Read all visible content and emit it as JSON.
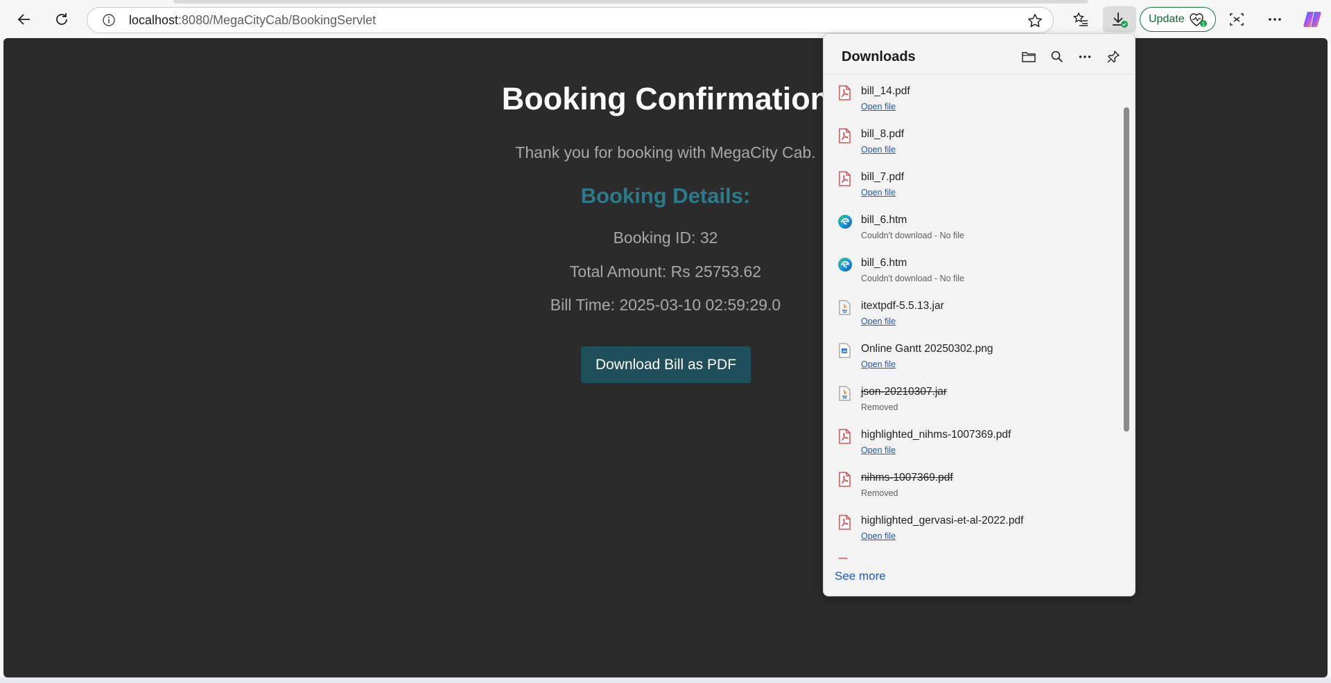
{
  "browser": {
    "url_host": "localhost",
    "url_path": ":8080/MegaCityCab/BookingServlet",
    "update_label": "Update",
    "colors": {
      "update_border": "#0b7a3a",
      "download_badge": "#16a34a"
    }
  },
  "page": {
    "title": "Booking Confirmation",
    "thanks": "Thank you for booking with MegaCity Cab.",
    "details_heading": "Booking Details:",
    "booking_id": "Booking ID: 32",
    "total_amount": "Total Amount: Rs 25753.62",
    "bill_time": "Bill Time: 2025-03-10 02:59:29.0",
    "download_button": "Download Bill as PDF",
    "colors": {
      "background": "#2b2b2b",
      "heading": "#2c7a8b",
      "button": "#1f4f5a"
    }
  },
  "downloads": {
    "title": "Downloads",
    "see_more": "See more",
    "items": [
      {
        "name": "bill_14.pdf",
        "status": "Open file",
        "icon": "pdf-icon",
        "removed": false,
        "link": true
      },
      {
        "name": "bill_8.pdf",
        "status": "Open file",
        "icon": "pdf-icon",
        "removed": false,
        "link": true
      },
      {
        "name": "bill_7.pdf",
        "status": "Open file",
        "icon": "pdf-icon",
        "removed": false,
        "link": true
      },
      {
        "name": "bill_6.htm",
        "status": "Couldn't download - No file",
        "icon": "edge-icon",
        "removed": false,
        "link": false
      },
      {
        "name": "bill_6.htm",
        "status": "Couldn't download - No file",
        "icon": "edge-icon",
        "removed": false,
        "link": false
      },
      {
        "name": "itextpdf-5.5.13.jar",
        "status": "Open file",
        "icon": "java-icon",
        "removed": false,
        "link": true
      },
      {
        "name": "Online Gantt 20250302.png",
        "status": "Open file",
        "icon": "image-icon",
        "removed": false,
        "link": true
      },
      {
        "name": "json-20210307.jar",
        "status": "Removed",
        "icon": "java-icon",
        "removed": true,
        "link": false
      },
      {
        "name": "highlighted_nihms-1007369.pdf",
        "status": "Open file",
        "icon": "pdf-icon",
        "removed": false,
        "link": true
      },
      {
        "name": "nihms-1007369.pdf",
        "status": "Removed",
        "icon": "pdf-icon",
        "removed": true,
        "link": false
      },
      {
        "name": "highlighted_gervasi-et-al-2022.pdf",
        "status": "Open file",
        "icon": "pdf-icon",
        "removed": false,
        "link": true
      },
      {
        "name": "",
        "status": "",
        "icon": "pdf-icon",
        "removed": false,
        "link": false
      }
    ]
  }
}
